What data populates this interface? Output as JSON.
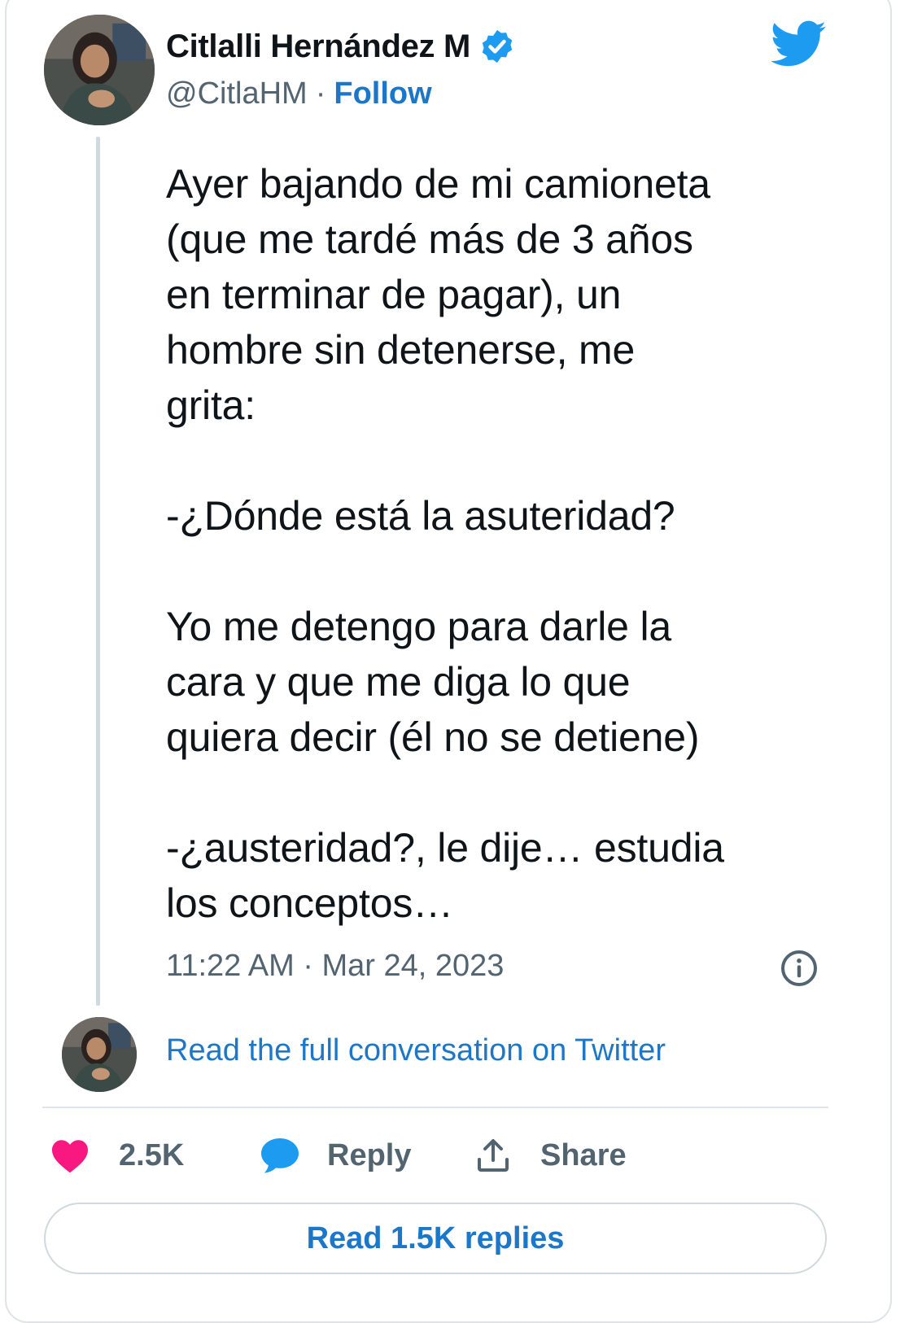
{
  "author": {
    "name": "Citlalli Hernández M",
    "handle": "@CitlaHM",
    "separator": "·",
    "follow_label": "Follow"
  },
  "tweet": {
    "text": "Ayer bajando de mi camioneta\n(que me tardé más de 3 años\nen terminar de pagar), un\nhombre sin detenerse, me\ngrita:\n\n-¿Dónde está la asuteridad?\n\nYo me detengo para darle la\ncara y que me diga lo que\nquiera decir (él no se detiene)\n\n-¿austeridad?, le dije… estudia\nlos conceptos…",
    "timestamp": "11:22 AM · Mar 24, 2023"
  },
  "conversation_link": "Read the full conversation on Twitter",
  "actions": {
    "likes_count": "2.5K",
    "reply_label": "Reply",
    "share_label": "Share"
  },
  "replies_button_label": "Read 1.5K replies",
  "icons": {
    "brand": "twitter-bird-icon",
    "verified": "verified-badge-icon",
    "info": "info-icon",
    "like": "heart-icon",
    "reply": "speech-bubble-icon",
    "share": "upload-icon"
  },
  "colors": {
    "brand_blue": "#1d9bf0",
    "link_blue": "#1d77c8",
    "heart_pink": "#f91880",
    "text_primary": "#0f1419",
    "text_secondary": "#536471",
    "border": "#cfd9de"
  }
}
